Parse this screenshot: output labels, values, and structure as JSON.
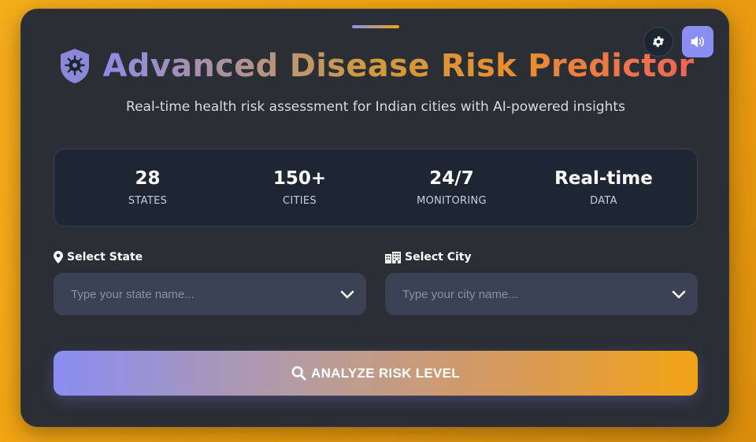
{
  "header": {
    "title": "Advanced Disease Risk Predictor",
    "subtitle": "Real-time health risk assessment for Indian cities with AI-powered insights",
    "icons": {
      "title": "virus-shield-icon",
      "settings": "gear-icon",
      "sound": "volume-icon"
    }
  },
  "stats": [
    {
      "value": "28",
      "label": "STATES"
    },
    {
      "value": "150+",
      "label": "CITIES"
    },
    {
      "value": "24/7",
      "label": "MONITORING"
    },
    {
      "value": "Real-time",
      "label": "DATA"
    }
  ],
  "form": {
    "state": {
      "label": "Select State",
      "icon": "map-pin-icon",
      "value": "",
      "placeholder": "Type your state name..."
    },
    "city": {
      "label": "Select City",
      "icon": "city-icon",
      "value": "",
      "placeholder": "Type your city name..."
    }
  },
  "action": {
    "label": "ANALYZE RISK LEVEL",
    "icon": "search-icon"
  },
  "colors": {
    "page_background": "#f0a312",
    "card_background": "#2a2e35",
    "accent_purple": "#8a8ef2",
    "accent_orange": "#f2a314",
    "stats_panel": "#1d2733",
    "input_background": "#3a4152"
  }
}
